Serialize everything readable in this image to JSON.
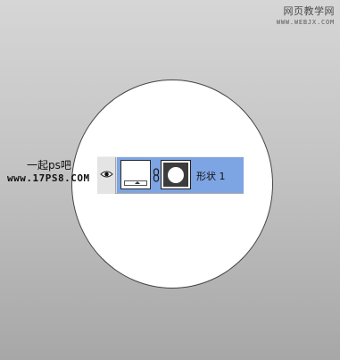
{
  "watermark_top": {
    "title": "网页教学网",
    "url": "WWW.WEBJX.COM"
  },
  "watermark_left": {
    "chinese": "一起ps吧",
    "site": "www.17PS8.COM"
  },
  "layer": {
    "name": "形状 1",
    "visibility_icon": "eye-icon",
    "link_icon": "chain-link-icon",
    "selected_color": "#7ea5e3"
  }
}
